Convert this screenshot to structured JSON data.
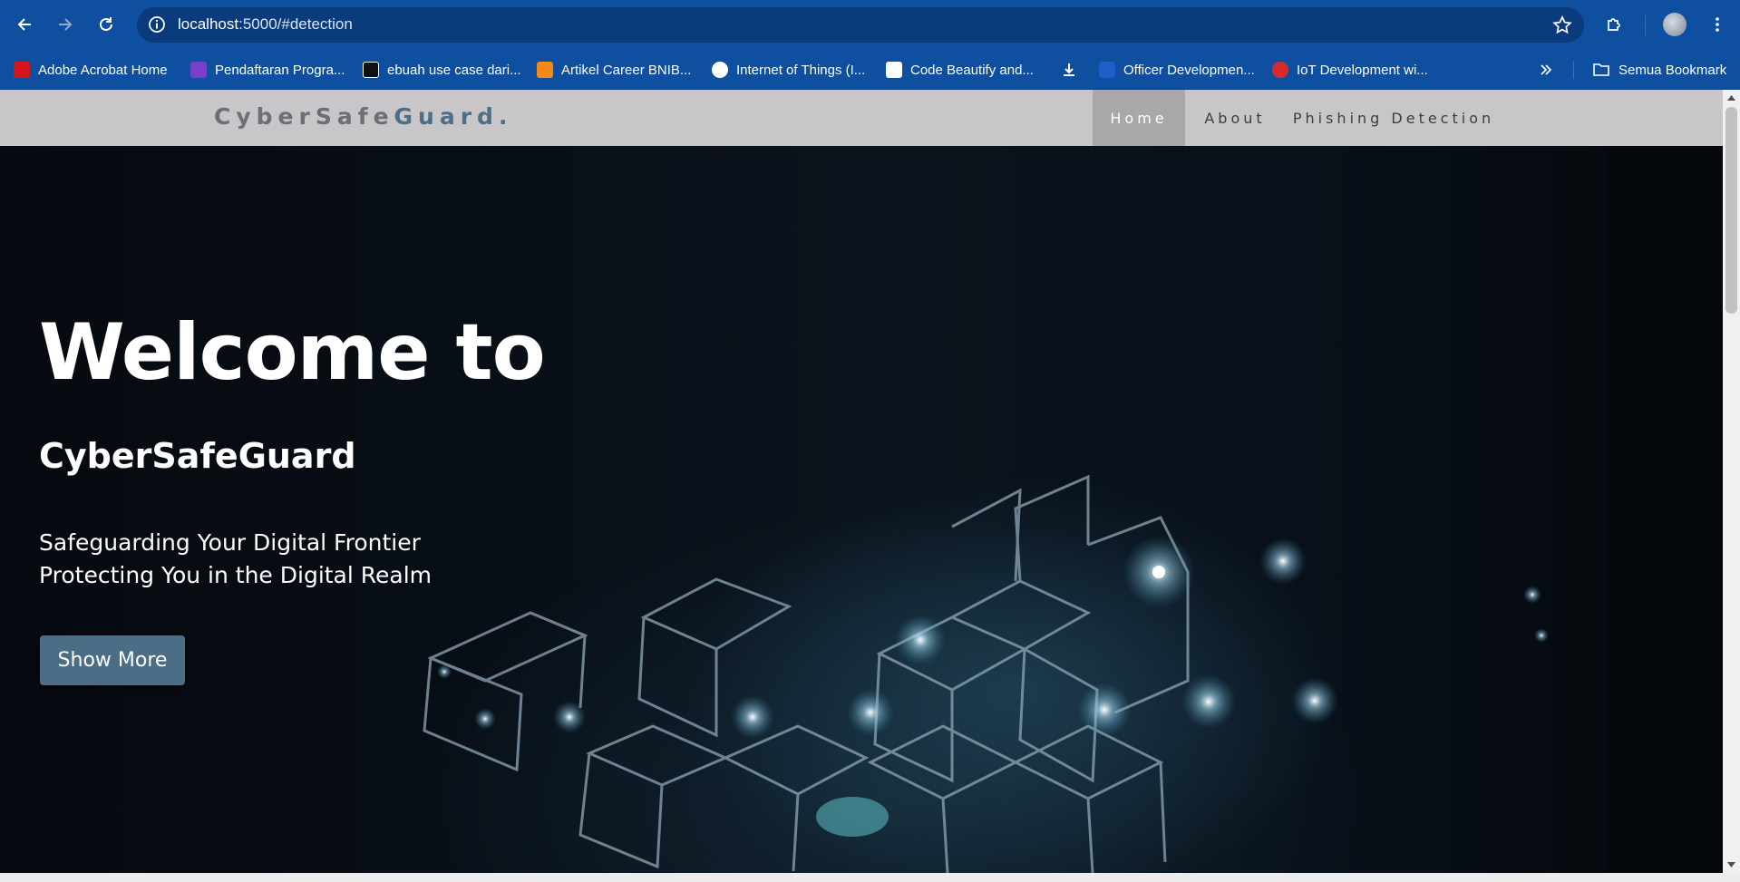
{
  "browser": {
    "url_host": "localhost",
    "url_rest": ":5000/#detection",
    "bookmarks": [
      {
        "label": "Adobe Acrobat Home",
        "icon": "adobe-acrobat-icon",
        "color": "#d7141a"
      },
      {
        "label": "Pendaftaran Progra...",
        "icon": "list-form-icon",
        "color": "#7a3fc8"
      },
      {
        "label": "ebuah use case dari...",
        "icon": "chatgpt-icon",
        "color": "#111111"
      },
      {
        "label": "Artikel Career BNIB...",
        "icon": "bni-icon",
        "color": "#f28a1a"
      },
      {
        "label": "Internet of Things (I...",
        "icon": "globe-icon",
        "color": "#ffffff"
      },
      {
        "label": "Code Beautify and...",
        "icon": "codebeautify-icon",
        "color": "#ffffff"
      },
      {
        "label": "",
        "icon": "download-icon",
        "color": "#ffffff"
      },
      {
        "label": "Officer Developmen...",
        "icon": "bank-logo-icon",
        "color": "#1c5fc8"
      },
      {
        "label": "IoT Development wi...",
        "icon": "iot-logo-icon",
        "color": "#d72a2a"
      }
    ],
    "all_bookmarks_label": "Semua Bookmark"
  },
  "navbar": {
    "logo_main": "CyberSafe",
    "logo_accent": "Guard.",
    "items": [
      {
        "label": "Home",
        "active": true
      },
      {
        "label": "About",
        "active": false
      },
      {
        "label": "Phishing Detection",
        "active": false
      }
    ]
  },
  "hero": {
    "heading": "Welcome to",
    "subheading": "CyberSafeGuard",
    "tagline_1": "Safeguarding Your Digital Frontier",
    "tagline_2": "Protecting You in the Digital Realm",
    "button_label": "Show More"
  },
  "colors": {
    "browser_chrome": "#0f4fa0",
    "navbar_bg": "#c8c6c9",
    "nav_active_bg": "#a9a7aa",
    "logo_accent": "#4c6e86",
    "button_bg": "#4b6e86"
  }
}
